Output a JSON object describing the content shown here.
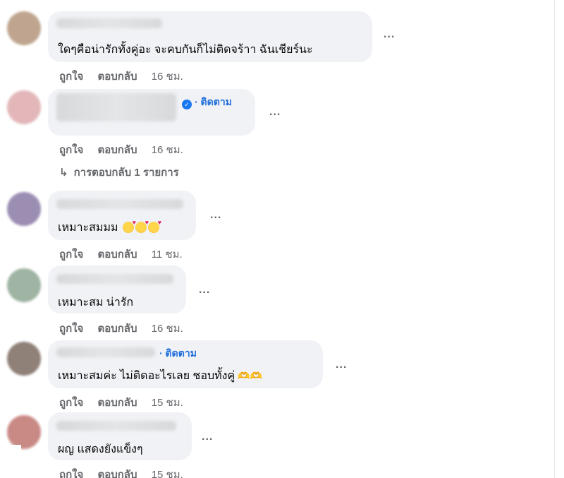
{
  "comments": [
    {
      "text": "ใดๆคือน่ารักทั้งคู่อะ จะคบกันก็ไม่ติดจร้าา ฉันเชียร์นะ",
      "actions": {
        "like": "ถูกใจ",
        "reply": "ตอบกลับ",
        "time": "16 ชม."
      },
      "avatar_color": "#bfa58f"
    },
    {
      "follow": "· ติดตาม",
      "verified": true,
      "actions": {
        "like": "ถูกใจ",
        "reply": "ตอบกลับ",
        "time": "16 ชม."
      },
      "replies": "การตอบกลับ 1 รายการ",
      "avatar_color": "#e3b7b9"
    },
    {
      "text": "เหมาะสมมม",
      "emoji": "smiling-face-with-hearts",
      "actions": {
        "like": "ถูกใจ",
        "reply": "ตอบกลับ",
        "time": "11 ชม."
      },
      "avatar_color": "#9c8db3"
    },
    {
      "text": "เหมาะสม น่ารัก",
      "actions": {
        "like": "ถูกใจ",
        "reply": "ตอบกลับ",
        "time": "16 ชม."
      },
      "avatar_color": "#9fb4a3"
    },
    {
      "follow": "· ติดตาม",
      "text": "เหมาะสมค่ะ ไม่ติดอะไรเลย ชอบทั้งคู่",
      "emoji": "heart-hands",
      "actions": {
        "like": "ถูกใจ",
        "reply": "ตอบกลับ",
        "time": "15 ชม."
      },
      "avatar_color": "#8f8078"
    },
    {
      "text": "ผญ แสดงยังแข็งๆ",
      "actions": {
        "like": "ถูกใจ",
        "reply": "ตอบกลับ",
        "time": "15 ชม."
      },
      "avatar_color": "#c98a86"
    }
  ],
  "more_icon": "...",
  "reply_arrow": "↳",
  "verified_icon": "✓",
  "hands_emoji": "🫶🫶"
}
